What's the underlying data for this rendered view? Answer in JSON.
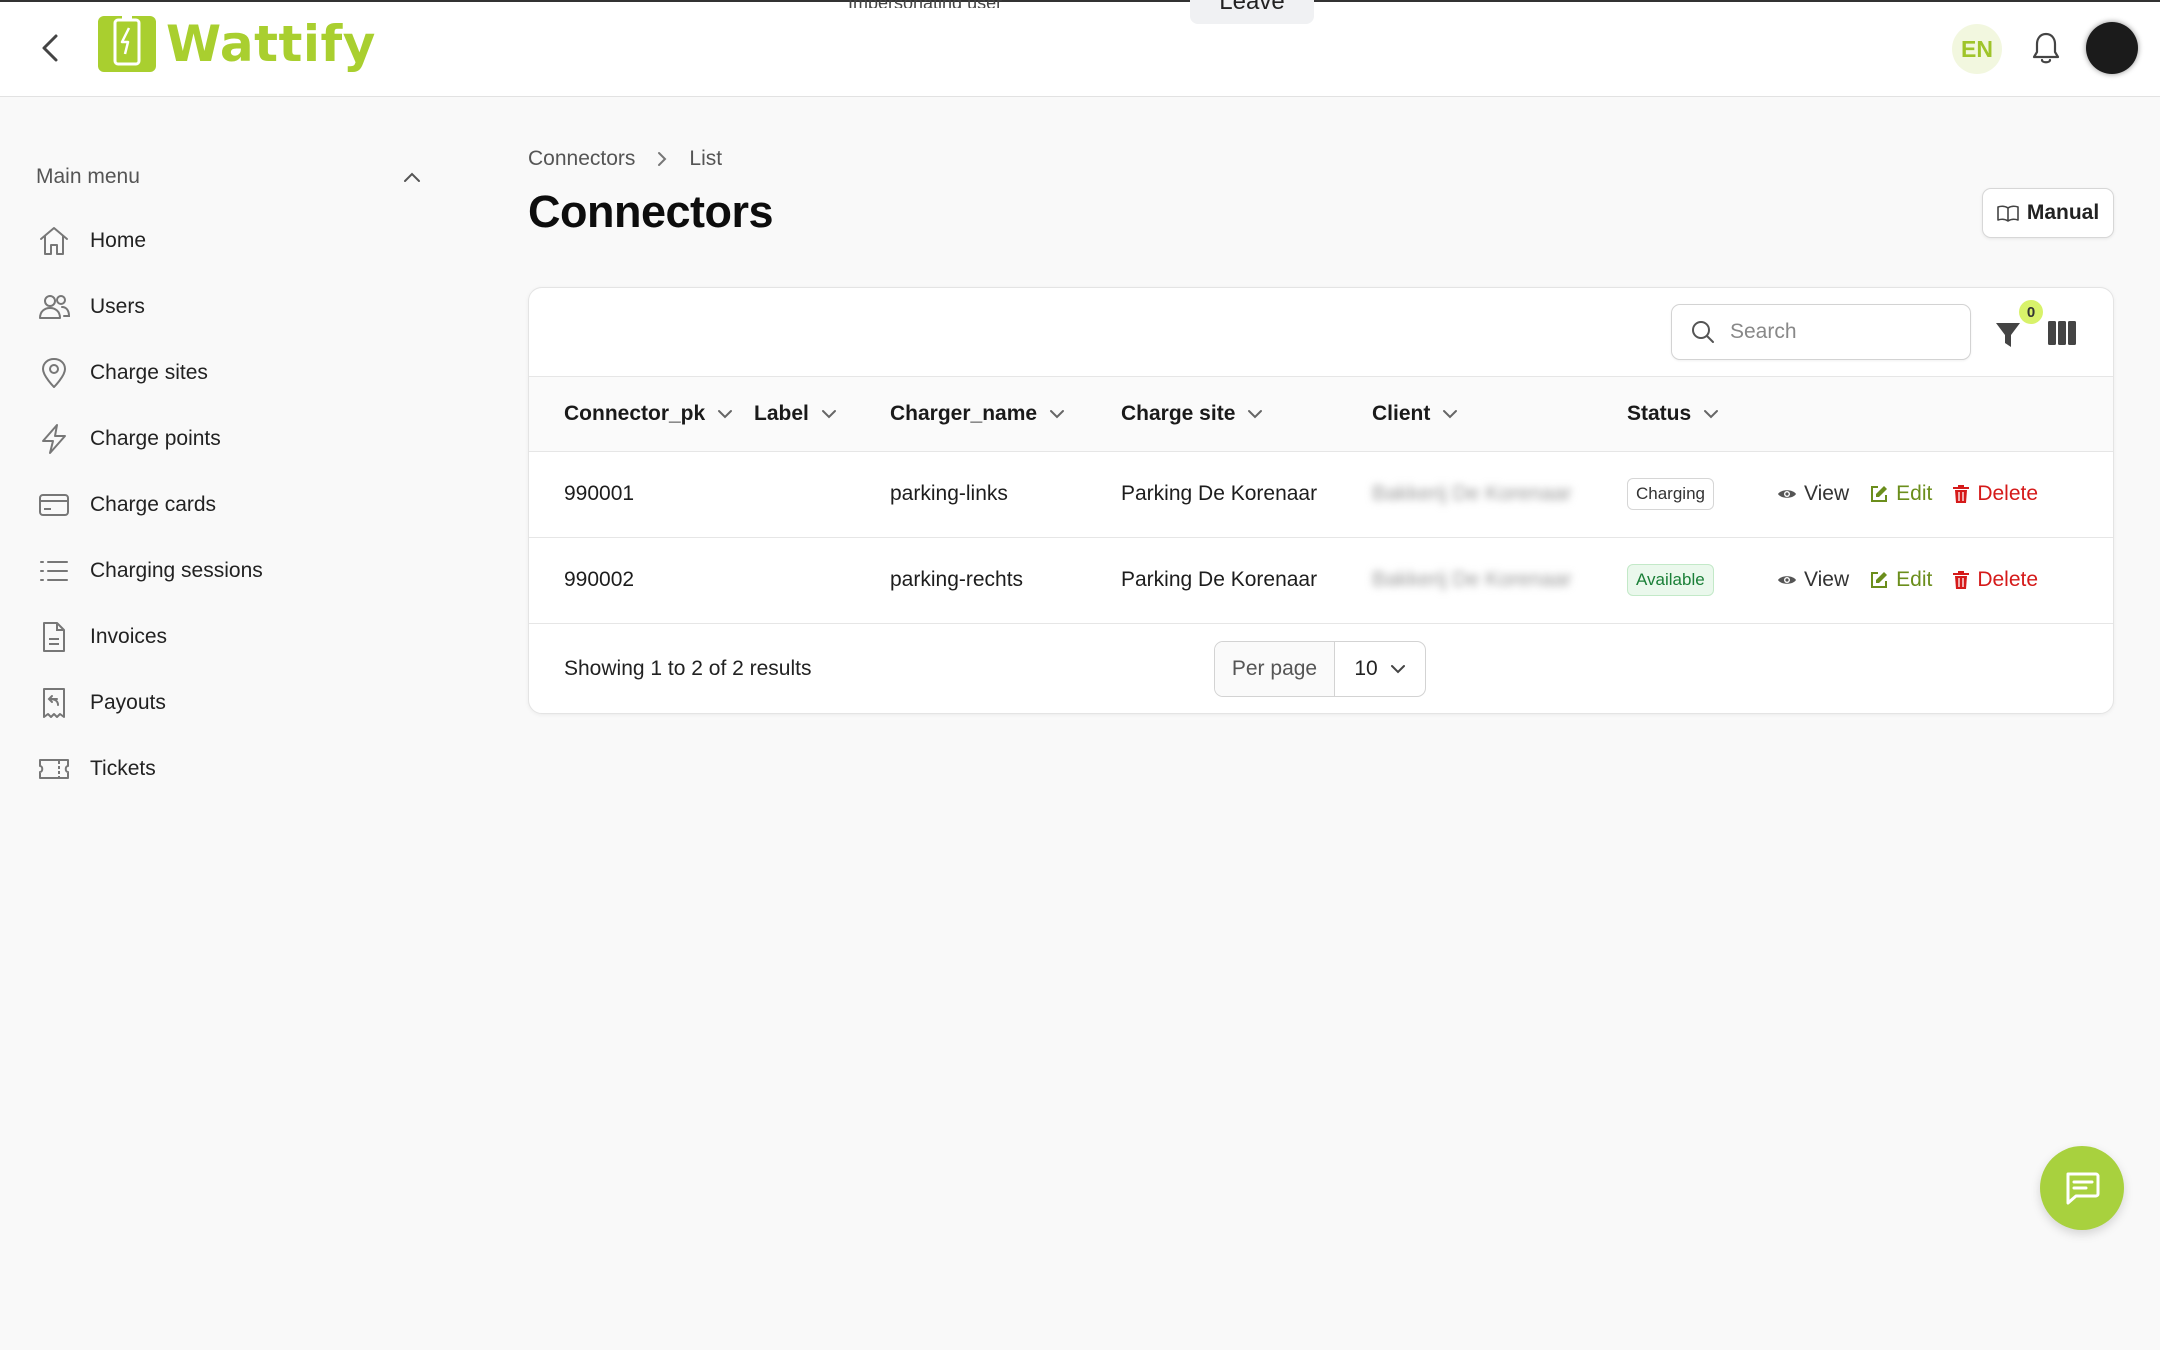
{
  "app": {
    "brand": "Wattify",
    "impersonation_text": "Impersonating user",
    "leave_label": "Leave",
    "language": "EN",
    "accent_color": "#a9cf2f"
  },
  "sidebar": {
    "header": "Main menu",
    "items": [
      {
        "label": "Home",
        "icon": "home-icon"
      },
      {
        "label": "Users",
        "icon": "users-icon"
      },
      {
        "label": "Charge sites",
        "icon": "map-pin-icon"
      },
      {
        "label": "Charge points",
        "icon": "lightning-icon"
      },
      {
        "label": "Charge cards",
        "icon": "card-icon"
      },
      {
        "label": "Charging sessions",
        "icon": "list-icon"
      },
      {
        "label": "Invoices",
        "icon": "document-icon"
      },
      {
        "label": "Payouts",
        "icon": "receipt-icon"
      },
      {
        "label": "Tickets",
        "icon": "ticket-icon"
      }
    ]
  },
  "breadcrumb": {
    "parent": "Connectors",
    "current": "List"
  },
  "page": {
    "title": "Connectors",
    "manual_label": "Manual"
  },
  "toolbar": {
    "search_placeholder": "Search",
    "filter_count": "0"
  },
  "table": {
    "columns": [
      "Connector_pk",
      "Label",
      "Charger_name",
      "Charge site",
      "Client",
      "Status"
    ],
    "rows": [
      {
        "connector_pk": "990001",
        "label": "",
        "charger_name": "parking-links",
        "charge_site": "Parking De Korenaar",
        "client": "Bakkerij De Korenaar",
        "status": "Charging"
      },
      {
        "connector_pk": "990002",
        "label": "",
        "charger_name": "parking-rechts",
        "charge_site": "Parking De Korenaar",
        "client": "Bakkerij De Korenaar",
        "status": "Available"
      }
    ],
    "actions": {
      "view": "View",
      "edit": "Edit",
      "delete": "Delete"
    }
  },
  "pagination": {
    "summary": "Showing 1 to 2 of 2 results",
    "per_page_label": "Per page",
    "per_page_value": "10"
  }
}
